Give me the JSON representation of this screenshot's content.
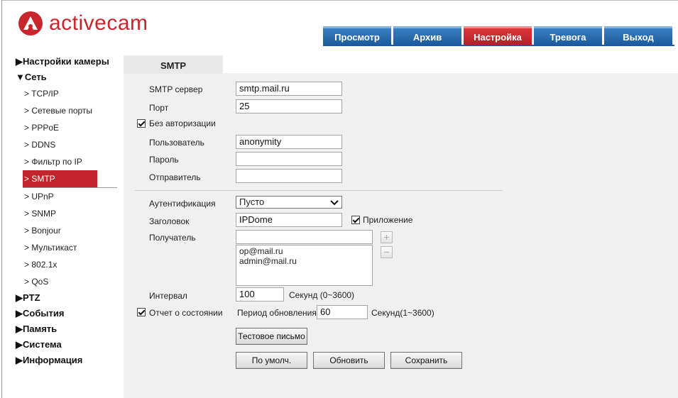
{
  "brand": {
    "name": "activecam",
    "color": "#c8262d"
  },
  "nav": {
    "tabs": [
      {
        "label": "Просмотр",
        "active": false
      },
      {
        "label": "Архив",
        "active": false
      },
      {
        "label": "Настройка",
        "active": true
      },
      {
        "label": "Тревога",
        "active": false
      },
      {
        "label": "Выход",
        "active": false
      }
    ]
  },
  "sidebar": {
    "camera_settings": "▶Настройки камеры",
    "network": "▼Сеть",
    "network_items": [
      "> TCP/IP",
      "> Сетевые порты",
      "> PPPoE",
      "> DDNS",
      "> Фильтр по IP",
      "> SMTP",
      "> UPnP",
      "> SNMP",
      "> Bonjour",
      "> Мультикаст",
      "> 802.1x",
      "> QoS"
    ],
    "active_item": "> SMTP",
    "ptz": "▶PTZ",
    "events": "▶События",
    "storage": "▶Память",
    "system": "▶Система",
    "info": "▶Информация"
  },
  "page": {
    "tab": "SMTP"
  },
  "form": {
    "smtp_server_label": "SMTP сервер",
    "smtp_server_value": "smtp.mail.ru",
    "port_label": "Порт",
    "port_value": "25",
    "no_auth_label": "Без авторизации",
    "no_auth_checked": true,
    "user_label": "Пользователь",
    "user_value": "anonymity",
    "password_label": "Пароль",
    "password_value": "",
    "sender_label": "Отправитель",
    "sender_value": "",
    "auth_label": "Аутентификация",
    "auth_value": "Пусто",
    "subject_label": "Заголовок",
    "subject_value": "IPDome",
    "attachment_label": "Приложение",
    "attachment_checked": true,
    "recipient_label": "Получатель",
    "recipient_value": "",
    "recipients": [
      "op@mail.ru",
      "admin@mail.ru"
    ],
    "add_symbol": "+",
    "remove_symbol": "−",
    "interval_label": "Интервал",
    "interval_value": "100",
    "interval_unit": "Секунд (0~3600)",
    "status_report_label": "Отчет о состоянии",
    "status_report_checked": true,
    "update_period_label": "Период обновления",
    "update_period_value": "60",
    "update_period_unit": "Секунд(1~3600)"
  },
  "buttons": {
    "test_mail": "Тестовое письмо",
    "default": "По умолч.",
    "refresh": "Обновить",
    "save": "Сохранить"
  }
}
